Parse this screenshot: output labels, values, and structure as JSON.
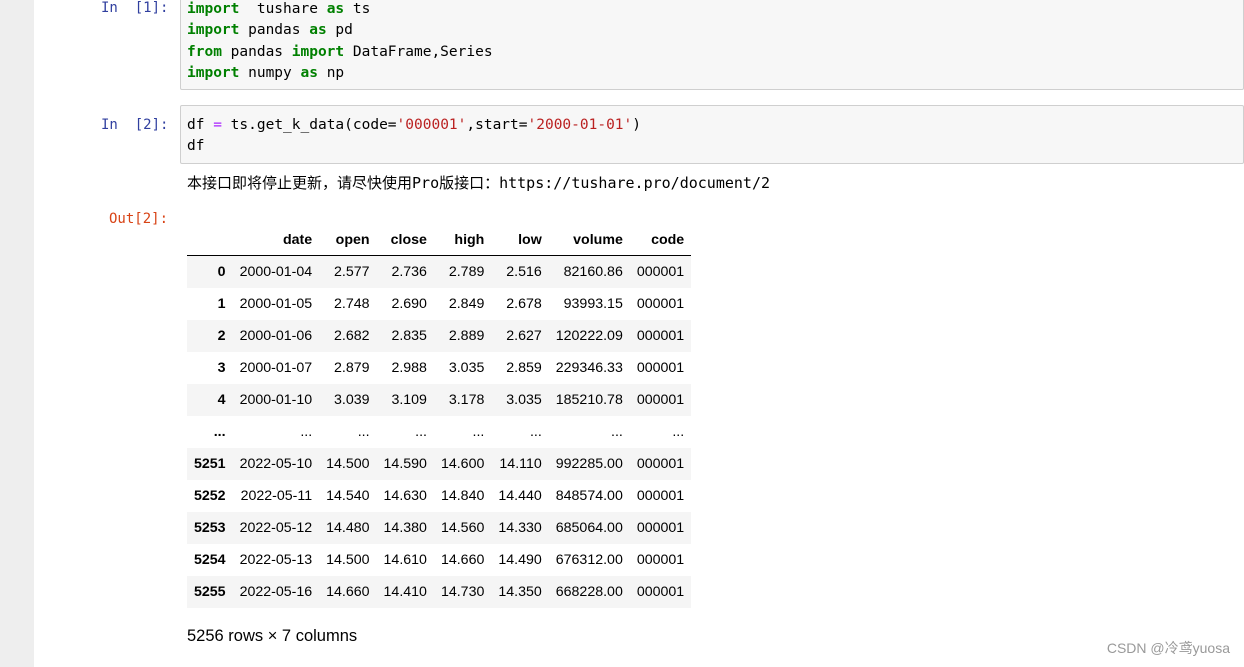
{
  "cells": [
    {
      "prompt": "In  [1]:",
      "code_lines": [
        [
          [
            "kw",
            "import"
          ],
          [
            "",
            "  tushare "
          ],
          [
            "kw",
            "as"
          ],
          [
            "",
            " ts"
          ]
        ],
        [
          [
            "kw",
            "import"
          ],
          [
            "",
            " pandas "
          ],
          [
            "kw",
            "as"
          ],
          [
            "",
            " pd"
          ]
        ],
        [
          [
            "kw",
            "from"
          ],
          [
            "",
            " pandas "
          ],
          [
            "kw",
            "import"
          ],
          [
            "",
            " DataFrame,Series"
          ]
        ],
        [
          [
            "kw",
            "import"
          ],
          [
            "",
            " numpy "
          ],
          [
            "kw",
            "as"
          ],
          [
            "",
            " np"
          ]
        ]
      ]
    },
    {
      "prompt": "In  [2]:",
      "code_lines": [
        [
          [
            "",
            "df "
          ],
          [
            "op",
            "="
          ],
          [
            "",
            " ts.get_k_data(code="
          ],
          [
            "str",
            "'000001'"
          ],
          [
            "",
            ",start="
          ],
          [
            "str",
            "'2000-01-01'"
          ],
          [
            "",
            ")"
          ]
        ],
        [
          [
            "",
            "df"
          ]
        ]
      ]
    }
  ],
  "stderr_text": "本接口即将停止更新，请尽快使用Pro版接口：https://tushare.pro/document/2",
  "out_prompt": "Out[2]:",
  "table": {
    "columns": [
      "",
      "date",
      "open",
      "close",
      "high",
      "low",
      "volume",
      "code"
    ],
    "rows": [
      [
        "0",
        "2000-01-04",
        "2.577",
        "2.736",
        "2.789",
        "2.516",
        "82160.86",
        "000001"
      ],
      [
        "1",
        "2000-01-05",
        "2.748",
        "2.690",
        "2.849",
        "2.678",
        "93993.15",
        "000001"
      ],
      [
        "2",
        "2000-01-06",
        "2.682",
        "2.835",
        "2.889",
        "2.627",
        "120222.09",
        "000001"
      ],
      [
        "3",
        "2000-01-07",
        "2.879",
        "2.988",
        "3.035",
        "2.859",
        "229346.33",
        "000001"
      ],
      [
        "4",
        "2000-01-10",
        "3.039",
        "3.109",
        "3.178",
        "3.035",
        "185210.78",
        "000001"
      ],
      [
        "...",
        "...",
        "...",
        "...",
        "...",
        "...",
        "...",
        "..."
      ],
      [
        "5251",
        "2022-05-10",
        "14.500",
        "14.590",
        "14.600",
        "14.110",
        "992285.00",
        "000001"
      ],
      [
        "5252",
        "2022-05-11",
        "14.540",
        "14.630",
        "14.840",
        "14.440",
        "848574.00",
        "000001"
      ],
      [
        "5253",
        "2022-05-12",
        "14.480",
        "14.380",
        "14.560",
        "14.330",
        "685064.00",
        "000001"
      ],
      [
        "5254",
        "2022-05-13",
        "14.500",
        "14.610",
        "14.660",
        "14.490",
        "676312.00",
        "000001"
      ],
      [
        "5255",
        "2022-05-16",
        "14.660",
        "14.410",
        "14.730",
        "14.350",
        "668228.00",
        "000001"
      ]
    ]
  },
  "shape_text": "5256 rows × 7 columns",
  "watermark": "CSDN @冷鸢yuosa"
}
